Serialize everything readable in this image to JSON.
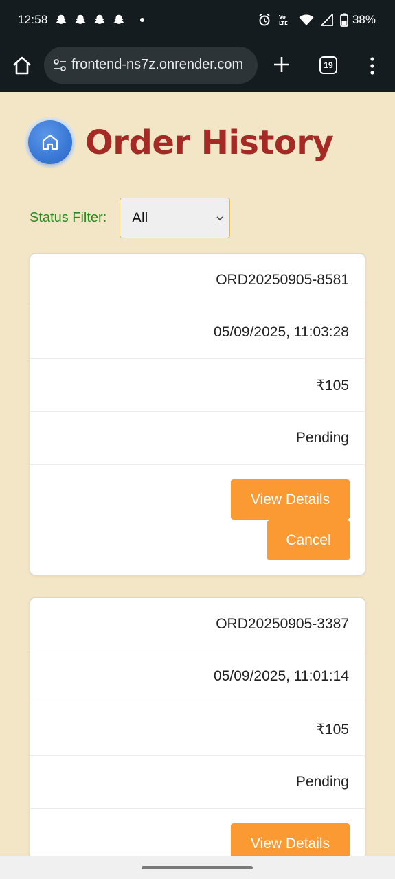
{
  "status_bar": {
    "time": "12:58",
    "battery": "38%",
    "icons": [
      "snapchat-icon",
      "snapchat-icon",
      "snapchat-icon",
      "snapchat-icon",
      "dot-icon",
      "alarm-icon",
      "volte-icon",
      "wifi-icon",
      "signal-icon",
      "battery-icon"
    ]
  },
  "browser": {
    "url": "frontend-ns7z.onrender.com",
    "tab_count": "19"
  },
  "header": {
    "title": "Order History"
  },
  "filter": {
    "label": "Status Filter:",
    "selected": "All"
  },
  "orders": [
    {
      "id": "ORD20250905-8581",
      "datetime": "05/09/2025, 11:03:28",
      "amount": "₹105",
      "status": "Pending",
      "view_label": "View Details",
      "cancel_label": "Cancel"
    },
    {
      "id": "ORD20250905-3387",
      "datetime": "05/09/2025, 11:01:14",
      "amount": "₹105",
      "status": "Pending",
      "view_label": "View Details"
    }
  ],
  "colors": {
    "page_bg": "#f3e6c6",
    "title": "#a52a25",
    "filter_label": "#2a8a1f",
    "button": "#fb9a33",
    "home_button": "#3a78d6"
  }
}
